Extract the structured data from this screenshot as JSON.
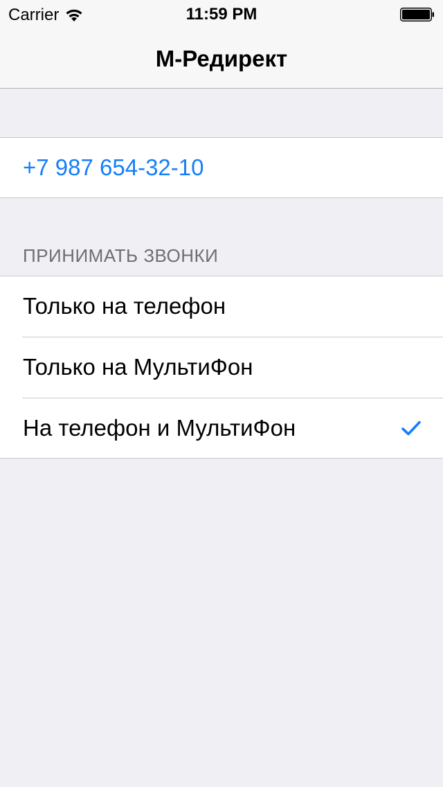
{
  "status_bar": {
    "carrier": "Carrier",
    "time": "11:59 PM"
  },
  "nav": {
    "title": "М-Редирект"
  },
  "phone": {
    "number": "+7 987 654-32-10"
  },
  "calls_section": {
    "header": "ПРИНИМАТЬ ЗВОНКИ",
    "options": [
      {
        "label": "Только на телефон",
        "selected": false
      },
      {
        "label": "Только на МультиФон",
        "selected": false
      },
      {
        "label": "На телефон и МультиФон",
        "selected": true
      }
    ]
  },
  "colors": {
    "accent": "#147efb",
    "background": "#efeff4",
    "nav_background": "#f7f7f7",
    "section_header": "#6d6d72"
  },
  "icons": {
    "wifi": "wifi-icon",
    "battery": "battery-icon",
    "checkmark": "checkmark-icon"
  }
}
